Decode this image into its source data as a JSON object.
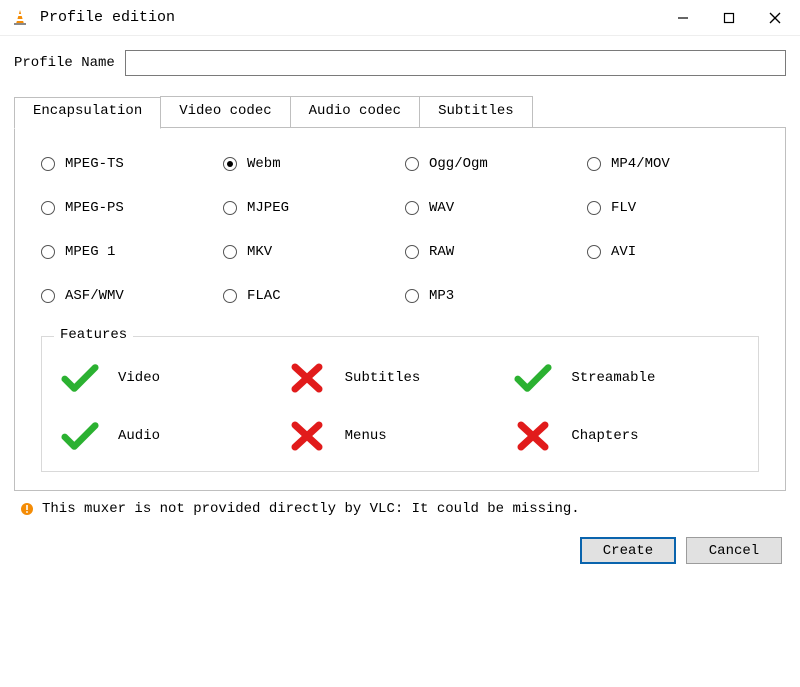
{
  "window": {
    "title": "Profile edition"
  },
  "profile": {
    "label": "Profile Name",
    "value": ""
  },
  "tabs": [
    {
      "label": "Encapsulation",
      "active": true
    },
    {
      "label": "Video codec",
      "active": false
    },
    {
      "label": "Audio codec",
      "active": false
    },
    {
      "label": "Subtitles",
      "active": false
    }
  ],
  "encapsulation": {
    "options": [
      {
        "label": "MPEG-TS",
        "selected": false
      },
      {
        "label": "Webm",
        "selected": true
      },
      {
        "label": "Ogg/Ogm",
        "selected": false
      },
      {
        "label": "MP4/MOV",
        "selected": false
      },
      {
        "label": "MPEG-PS",
        "selected": false
      },
      {
        "label": "MJPEG",
        "selected": false
      },
      {
        "label": "WAV",
        "selected": false
      },
      {
        "label": "FLV",
        "selected": false
      },
      {
        "label": "MPEG 1",
        "selected": false
      },
      {
        "label": "MKV",
        "selected": false
      },
      {
        "label": "RAW",
        "selected": false
      },
      {
        "label": "AVI",
        "selected": false
      },
      {
        "label": "ASF/WMV",
        "selected": false
      },
      {
        "label": "FLAC",
        "selected": false
      },
      {
        "label": "MP3",
        "selected": false
      }
    ]
  },
  "features": {
    "title": "Features",
    "items": [
      {
        "label": "Video",
        "state": "ok"
      },
      {
        "label": "Subtitles",
        "state": "no"
      },
      {
        "label": "Streamable",
        "state": "ok"
      },
      {
        "label": "Audio",
        "state": "ok"
      },
      {
        "label": "Menus",
        "state": "no"
      },
      {
        "label": "Chapters",
        "state": "no"
      }
    ]
  },
  "warning": {
    "text": "This muxer is not provided directly by VLC: It could be missing."
  },
  "buttons": {
    "create": "Create",
    "cancel": "Cancel"
  },
  "colors": {
    "ok": "#2bb131",
    "no": "#e11b1b",
    "accent": "#0a64ad"
  }
}
